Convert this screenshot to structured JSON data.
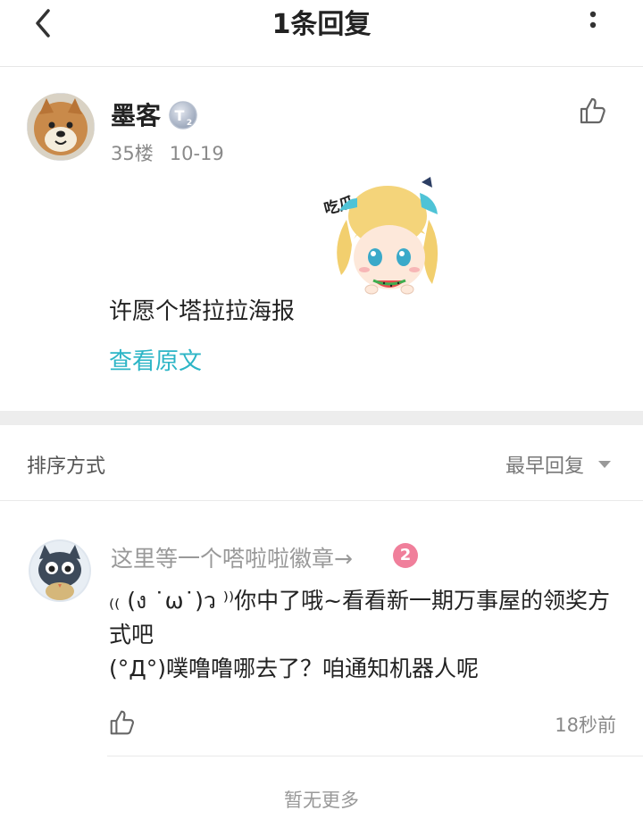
{
  "header": {
    "title": "1条回复",
    "back_icon": "chevron-left-icon",
    "more_icon": "vertical-dots-icon"
  },
  "post": {
    "author": "墨客",
    "badge_icon": "t2-level-badge",
    "floor": "35楼",
    "date": "10-19",
    "content": "许愿个塔拉拉海报",
    "view_original": "查看原文",
    "sticker_caption": "吃瓜…",
    "like_icon": "thumbs-up-icon"
  },
  "sort": {
    "label": "排序方式",
    "value": "最早回复",
    "arrow_icon": "triangle-down-icon"
  },
  "reply": {
    "author": "这里等一个嗒啦啦徽章→",
    "level": "2",
    "lines": [
      "₍₍ (ง ˙ω˙)ว ⁾⁾你中了哦~看看新一期万事屋的领奖方式吧",
      "(°Д°)噗噜噜哪去了？咱通知机器人呢"
    ],
    "time": "18秒前",
    "like_icon": "thumbs-up-icon"
  },
  "footer": {
    "no_more": "暂无更多"
  },
  "colors": {
    "link": "#2cb5c6",
    "muted": "#8a8a8a",
    "band": "#ededed",
    "level_badge": "#f07f9b"
  }
}
